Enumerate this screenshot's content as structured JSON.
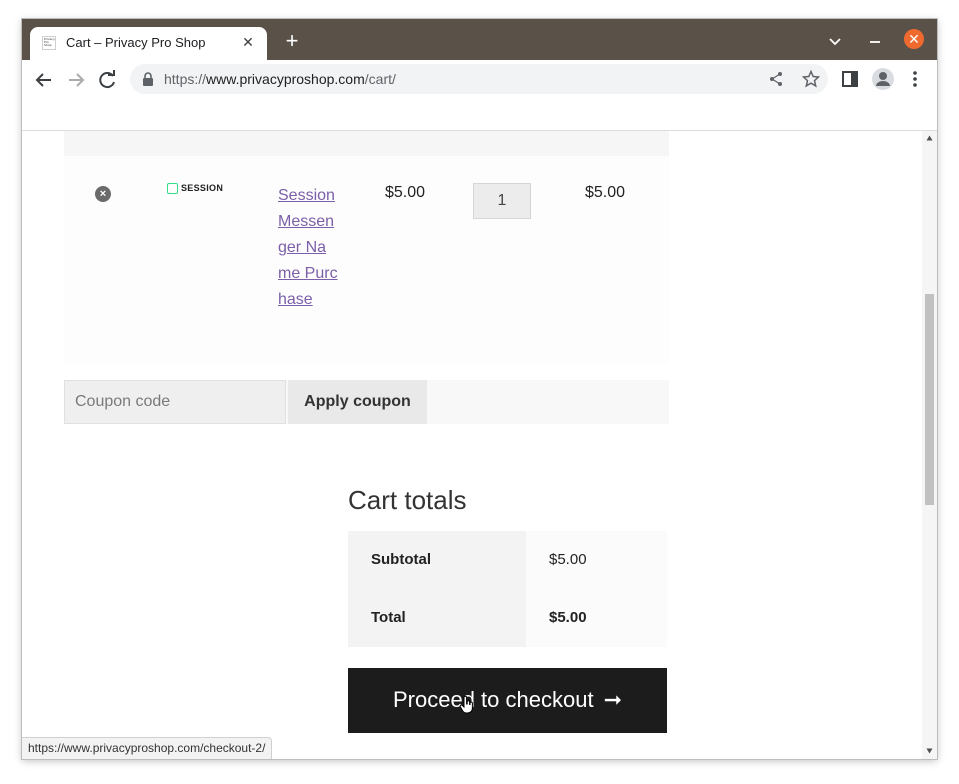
{
  "browser": {
    "tab_title": "Cart – Privacy Pro Shop",
    "url_prefix": "https://",
    "url_host": "www.privacyproshop.com",
    "url_path": "/cart/",
    "status_url": "https://www.privacyproshop.com/checkout-2/"
  },
  "cart": {
    "item": {
      "remove_symbol": "×",
      "thumb_text": "SESSION",
      "name": "Session Messenger Name Purchase",
      "price": "$5.00",
      "quantity": "1",
      "subtotal": "$5.00"
    },
    "coupon": {
      "placeholder": "Coupon code",
      "apply_label": "Apply coupon"
    }
  },
  "totals": {
    "title": "Cart totals",
    "subtotal_label": "Subtotal",
    "subtotal_value": "$5.00",
    "total_label": "Total",
    "total_value": "$5.00",
    "checkout_label": "Proceed to checkout",
    "checkout_arrow": "➞"
  },
  "colors": {
    "tabstrip": "#5a5149",
    "link": "#7b5fa8",
    "checkout_bg": "#1c1c1c",
    "close_button": "#f06a30"
  }
}
